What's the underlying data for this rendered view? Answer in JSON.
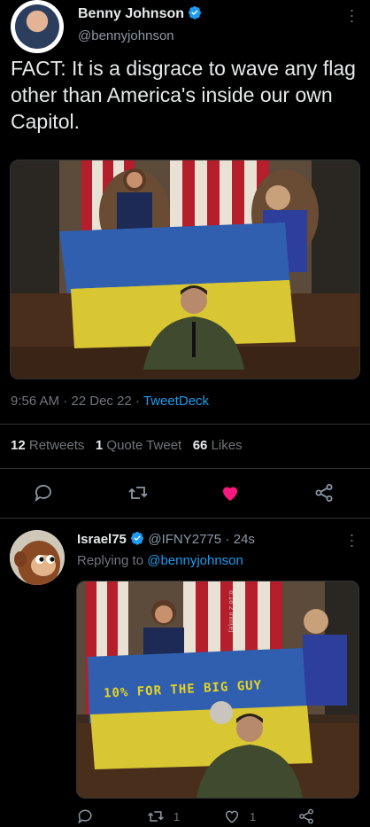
{
  "tweet": {
    "author_name": "Benny Johnson",
    "author_handle": "@bennyjohnson",
    "text": "FACT: It is a disgrace to wave any flag other than America's inside our own Capitol.",
    "time": "9:56 AM",
    "date": "22 Dec 22",
    "source": "TweetDeck",
    "separator": "·",
    "retweets_count": "12",
    "retweets_label": "Retweets",
    "quote_count": "1",
    "quote_label": "Quote Tweet",
    "likes_count": "66",
    "likes_label": "Likes",
    "like_color": "#f91880"
  },
  "reply": {
    "author_name": "Israel75",
    "author_handle": "@IFNY2775",
    "time": "· 24s",
    "replying_prefix": "Replying to",
    "replying_to": "@bennyjohnson",
    "image_caption": "10% FOR THE BIG GUY",
    "image_watermark": "8:18 2 Ihm(e)",
    "retweet_count": "1",
    "like_count": "1"
  },
  "icons": {
    "verified": "verified-badge-icon",
    "reply": "comment-bubble-icon",
    "retweet": "retweet-icon",
    "like": "heart-icon",
    "share": "share-icon",
    "more": "more-dots-icon"
  },
  "colors": {
    "accent": "#1d9bf0",
    "background": "#000000",
    "muted": "#71767b"
  }
}
